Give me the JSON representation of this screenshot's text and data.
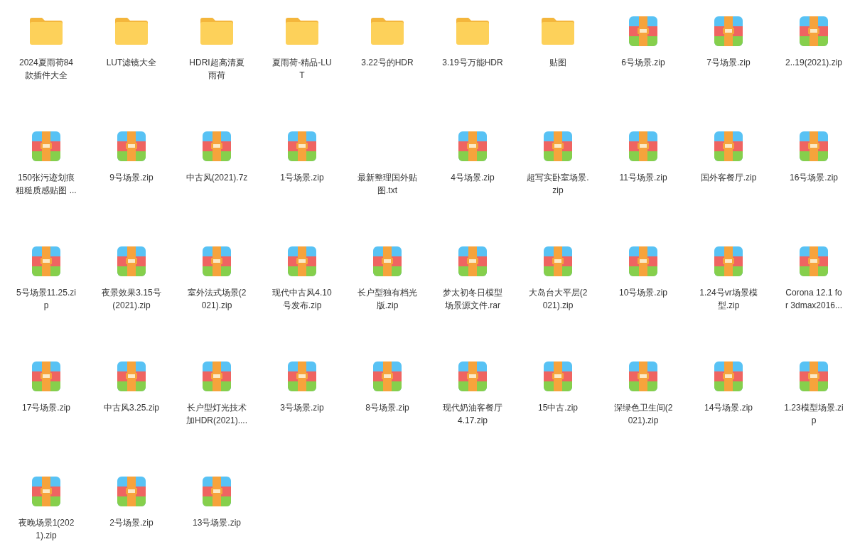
{
  "files": [
    {
      "kind": "folder",
      "lines": [
        "2024夏雨荷84",
        "款插件大全"
      ]
    },
    {
      "kind": "folder",
      "lines": [
        "LUT滤镜大全"
      ]
    },
    {
      "kind": "folder",
      "lines": [
        "HDRI超高清夏",
        "雨荷"
      ]
    },
    {
      "kind": "folder",
      "lines": [
        "夏雨荷-精品-LU",
        "T"
      ]
    },
    {
      "kind": "folder",
      "lines": [
        "3.22号的HDR"
      ]
    },
    {
      "kind": "folder",
      "lines": [
        "3.19号万能HDR"
      ]
    },
    {
      "kind": "folder",
      "lines": [
        "贴图"
      ]
    },
    {
      "kind": "archive",
      "lines": [
        "6号场景.zip"
      ]
    },
    {
      "kind": "archive",
      "lines": [
        "7号场景.zip"
      ]
    },
    {
      "kind": "archive",
      "lines": [
        "2..19(2021).zip"
      ]
    },
    {
      "kind": "archive",
      "lines": [
        "150张污迹划痕",
        "粗糙质感贴图 ..."
      ]
    },
    {
      "kind": "archive",
      "lines": [
        "9号场景.zip"
      ]
    },
    {
      "kind": "archive",
      "lines": [
        "中古风(2021).7z"
      ]
    },
    {
      "kind": "archive",
      "lines": [
        "1号场景.zip"
      ]
    },
    {
      "kind": "blank",
      "lines": [
        "最新整理国外贴",
        "图.txt"
      ]
    },
    {
      "kind": "archive",
      "lines": [
        "4号场景.zip"
      ]
    },
    {
      "kind": "archive",
      "lines": [
        "超写实卧室场景.",
        "zip"
      ]
    },
    {
      "kind": "archive",
      "lines": [
        "11号场景.zip"
      ]
    },
    {
      "kind": "archive",
      "lines": [
        "国外客餐厅.zip"
      ]
    },
    {
      "kind": "archive",
      "lines": [
        "16号场景.zip"
      ]
    },
    {
      "kind": "archive",
      "lines": [
        "5号场景11.25.zi",
        "p"
      ]
    },
    {
      "kind": "archive",
      "lines": [
        "夜景效果3.15号",
        "(2021).zip"
      ]
    },
    {
      "kind": "archive",
      "lines": [
        "室外法式场景(2",
        "021).zip"
      ]
    },
    {
      "kind": "archive",
      "lines": [
        "现代中古风4.10",
        "号发布.zip"
      ]
    },
    {
      "kind": "archive",
      "lines": [
        "长户型独有档光",
        "版.zip"
      ]
    },
    {
      "kind": "archive",
      "lines": [
        "梦太初冬日模型",
        "场景源文件.rar"
      ]
    },
    {
      "kind": "archive",
      "lines": [
        "大岛台大平层(2",
        "021).zip"
      ]
    },
    {
      "kind": "archive",
      "lines": [
        "10号场景.zip"
      ]
    },
    {
      "kind": "archive",
      "lines": [
        "1.24号vr场景模",
        "型.zip"
      ]
    },
    {
      "kind": "archive",
      "lines": [
        "Corona 12.1 fo",
        "r 3dmax2016..."
      ]
    },
    {
      "kind": "archive",
      "lines": [
        "17号场景.zip"
      ]
    },
    {
      "kind": "archive",
      "lines": [
        "中古风3.25.zip"
      ]
    },
    {
      "kind": "archive",
      "lines": [
        "长户型灯光技术",
        "加HDR(2021)...."
      ]
    },
    {
      "kind": "archive",
      "lines": [
        "3号场景.zip"
      ]
    },
    {
      "kind": "archive",
      "lines": [
        "8号场景.zip"
      ]
    },
    {
      "kind": "archive",
      "lines": [
        "现代奶油客餐厅",
        "4.17.zip"
      ]
    },
    {
      "kind": "archive",
      "lines": [
        "15中古.zip"
      ]
    },
    {
      "kind": "archive",
      "lines": [
        "深绿色卫生间(2",
        "021).zip"
      ]
    },
    {
      "kind": "archive",
      "lines": [
        "14号场景.zip"
      ]
    },
    {
      "kind": "archive",
      "lines": [
        "1.23模型场景.zi",
        "p"
      ]
    },
    {
      "kind": "archive",
      "lines": [
        "夜晚场景1(202",
        "1).zip"
      ]
    },
    {
      "kind": "archive",
      "lines": [
        "2号场景.zip"
      ]
    },
    {
      "kind": "archive",
      "lines": [
        "13号场景.zip"
      ]
    }
  ]
}
